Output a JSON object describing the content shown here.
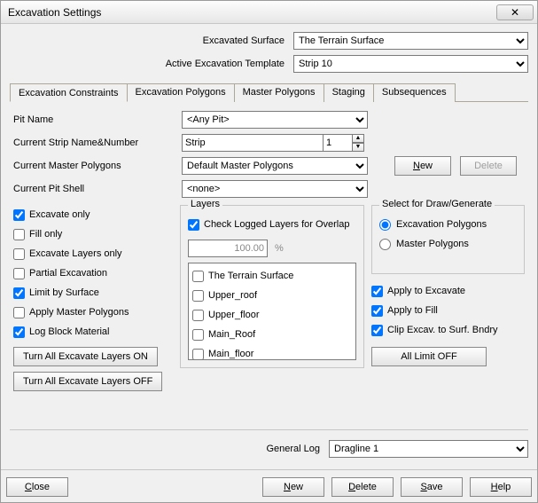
{
  "window": {
    "title": "Excavation Settings"
  },
  "header": {
    "surface_label": "Excavated Surface",
    "surface_value": "The Terrain Surface",
    "template_label": "Active Excavation Template",
    "template_value": "Strip 10"
  },
  "tabs": [
    {
      "label": "Excavation Constraints",
      "active": true
    },
    {
      "label": "Excavation Polygons"
    },
    {
      "label": "Master Polygons"
    },
    {
      "label": "Staging"
    },
    {
      "label": "Subsequences"
    }
  ],
  "form": {
    "pit_name_label": "Pit Name",
    "pit_name_value": "<Any Pit>",
    "strip_label": "Current Strip Name&Number",
    "strip_name_value": "Strip",
    "strip_number_value": "1",
    "master_poly_label": "Current Master Polygons",
    "master_poly_value": "Default Master Polygons",
    "shell_label": "Current Pit Shell",
    "shell_value": "<none>",
    "new_btn": "New",
    "delete_btn": "Delete"
  },
  "checks_left": {
    "excavate_only": "Excavate only",
    "fill_only": "Fill only",
    "excavate_layers_only": "Excavate Layers only",
    "partial_excavation": "Partial Excavation",
    "limit_by_surface": "Limit by Surface",
    "apply_master_polygons": "Apply Master Polygons",
    "log_block_material": "Log Block Material",
    "turn_on": "Turn All Excavate Layers ON",
    "turn_off": "Turn All Excavate Layers OFF"
  },
  "layers": {
    "title": "Layers",
    "check_overlap": "Check Logged Layers for Overlap",
    "percent_value": "100.00",
    "percent_suffix": "%",
    "items": [
      "The Terrain Surface",
      "Upper_roof",
      "Upper_floor",
      "Main_Roof",
      "Main_floor"
    ]
  },
  "drawgen": {
    "title": "Select for Draw/Generate",
    "excavation_polygons": "Excavation Polygons",
    "master_polygons": "Master Polygons"
  },
  "right_checks": {
    "apply_excavate": "Apply to Excavate",
    "apply_fill": "Apply to Fill",
    "clip": "Clip Excav. to Surf. Bndry",
    "all_limit_off": "All Limit OFF"
  },
  "footer": {
    "general_log_label": "General Log",
    "general_log_value": "Dragline 1",
    "close": "Close",
    "new": "New",
    "delete": "Delete",
    "save": "Save",
    "help": "Help"
  }
}
